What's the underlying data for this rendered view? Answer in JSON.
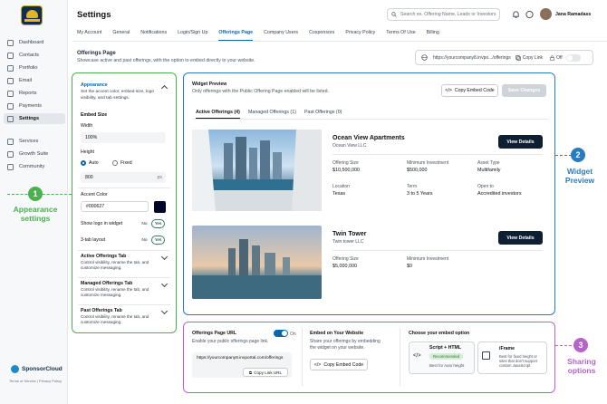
{
  "app": {
    "title": "Settings",
    "brand": "SponsorCloud",
    "footer": "Terms of Service | Privacy Policy"
  },
  "header": {
    "search_placeholder": "Search ex. Offering Name, Leads or Investors",
    "user_name": "Jana Ramadass"
  },
  "sidebar": {
    "items": [
      {
        "label": "Dashboard",
        "icon": "dashboard-icon"
      },
      {
        "label": "Contacts",
        "icon": "contacts-icon"
      },
      {
        "label": "Portfolio",
        "icon": "portfolio-icon"
      },
      {
        "label": "Email",
        "icon": "email-icon"
      },
      {
        "label": "Reports",
        "icon": "reports-icon"
      },
      {
        "label": "Payments",
        "icon": "payments-icon"
      },
      {
        "label": "Settings",
        "icon": "gear-icon",
        "active": true
      },
      {
        "label": "Services",
        "icon": "services-icon"
      },
      {
        "label": "Growth Suite",
        "icon": "growth-icon"
      },
      {
        "label": "Community",
        "icon": "community-icon"
      }
    ]
  },
  "tabs": [
    "My Account",
    "General",
    "Notifications",
    "Login/Sign Up",
    "Offerings Page",
    "Company Users",
    "Cosponsors",
    "Privacy Policy",
    "Terms Of Use",
    "Billing"
  ],
  "page": {
    "title": "Offerings Page",
    "subtitle": "Showcase active and past offerings, with the option to embed directly to your website.",
    "url": "https://yourcompany8.invpo.../offerings",
    "copy_link": "Copy Link",
    "off": "Off"
  },
  "appearance": {
    "title": "Appearance",
    "desc": "Set the accent color, embed size, logo visibility, and tab settings.",
    "embed_size": "Embed Size",
    "width_label": "Width",
    "width_value": "100%",
    "height_label": "Height",
    "auto": "Auto",
    "fixed": "Fixed",
    "height_value": "800",
    "px": "px",
    "accent_label": "Accent Color",
    "accent_value": "#000627",
    "show_logo": "Show logo in widget",
    "tab_layout": "3-tab layout",
    "no": "No",
    "yes": "Yes",
    "sections": [
      {
        "title": "Active Offerings Tab",
        "desc": "Control visibility, rename the tab, and customize messaging."
      },
      {
        "title": "Managed Offerings Tab",
        "desc": "Control visibility, rename the tab, and customize messaging."
      },
      {
        "title": "Past Offerings Tab",
        "desc": "Control visibility, rename the tab, and customize messaging."
      }
    ]
  },
  "widget": {
    "title": "Widget Preview",
    "subtitle": "Only offerings with the Public Offering Page enabled will be listed.",
    "embed_btn": "Copy Embed Code",
    "save_btn": "Save Changes",
    "tabs": [
      "Active Offerings (4)",
      "Managed Offerings (1)",
      "Past Offerings (0)"
    ],
    "offerings": [
      {
        "name": "Ocean View Apartments",
        "company": "Ocean View LLC",
        "button": "View Details",
        "fields": [
          [
            "Offering Size",
            "$10,500,000"
          ],
          [
            "Minimum Investment",
            "$500,000"
          ],
          [
            "Asset Type",
            "Multifamily"
          ],
          [
            "Location",
            "Texas"
          ],
          [
            "Term",
            "3 to 5 Years"
          ],
          [
            "Open to",
            "Accredited investors"
          ]
        ]
      },
      {
        "name": "Twin Tower",
        "company": "Twin tower LLC",
        "button": "View Details",
        "fields": [
          [
            "Offering Size",
            "$5,000,000"
          ],
          [
            "Minimum Investment",
            "$0"
          ]
        ]
      }
    ]
  },
  "sharing": {
    "url_title": "Offerings Page URL",
    "url_desc": "Enable your public offerings page link.",
    "on": "On",
    "url_value": "https://yourcompany8.invportal.com/offerings",
    "copy_url": "Copy Link URL",
    "embed_title": "Embed on Your Website",
    "embed_desc": "Share your offerings by embedding the widget on your website.",
    "copy_code": "Copy Embed Code",
    "choose_title": "Choose your embed option",
    "opt1_title": "Script + HTML",
    "opt1_badge": "Recommended",
    "opt1_desc": "Best for Auto height",
    "opt2_title": "iFrame",
    "opt2_desc": "Best for fixed height or sites that don't support custom JavaScript"
  },
  "callouts": [
    {
      "num": "1",
      "label": "Appearance settings",
      "color": "#4caf50"
    },
    {
      "num": "2",
      "label": "Widget Preview",
      "color": "#2b7bbf"
    },
    {
      "num": "3",
      "label": "Sharing options",
      "color": "#b565c9"
    }
  ]
}
